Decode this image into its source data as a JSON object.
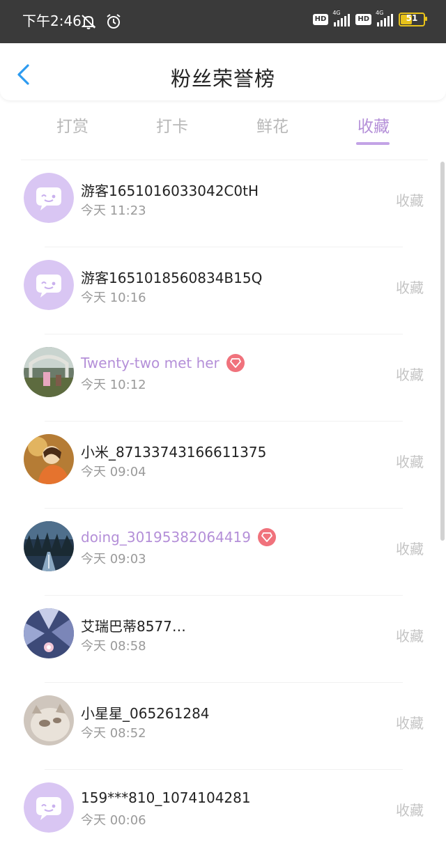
{
  "status_bar": {
    "time": "下午2:46",
    "network_1": "4G",
    "network_2": "4G",
    "hd": "HD",
    "battery": "51"
  },
  "header": {
    "title": "粉丝荣誉榜"
  },
  "tabs": [
    {
      "label": "打赏"
    },
    {
      "label": "打卡"
    },
    {
      "label": "鲜花"
    },
    {
      "label": "收藏"
    }
  ],
  "active_tab": "收藏",
  "list": [
    {
      "name": "游客1651016033042C0tH",
      "time": "今天 11:23",
      "action": "收藏"
    },
    {
      "name": "游客1651018560834B15Q",
      "time": "今天 10:16",
      "action": "收藏"
    },
    {
      "name": "Twenty-two met her",
      "time": "今天 10:12",
      "action": "收藏"
    },
    {
      "name": "小米_87133743166611375",
      "time": "今天 09:04",
      "action": "收藏"
    },
    {
      "name": "doing_30195382064419",
      "time": "今天 09:03",
      "action": "收藏"
    },
    {
      "name": "艾瑞巴蒂8577…",
      "time": "今天 08:58",
      "action": "收藏"
    },
    {
      "name": "小星星_065261284",
      "time": "今天 08:52",
      "action": "收藏"
    },
    {
      "name": "159***810_1074104281",
      "time": "今天 00:06",
      "action": "收藏"
    }
  ],
  "colors": {
    "accent": "#b48fd8",
    "status_bar_bg": "#3a3a3a",
    "vip_badge": "#f0727c",
    "back_arrow": "#2d9bf0"
  }
}
